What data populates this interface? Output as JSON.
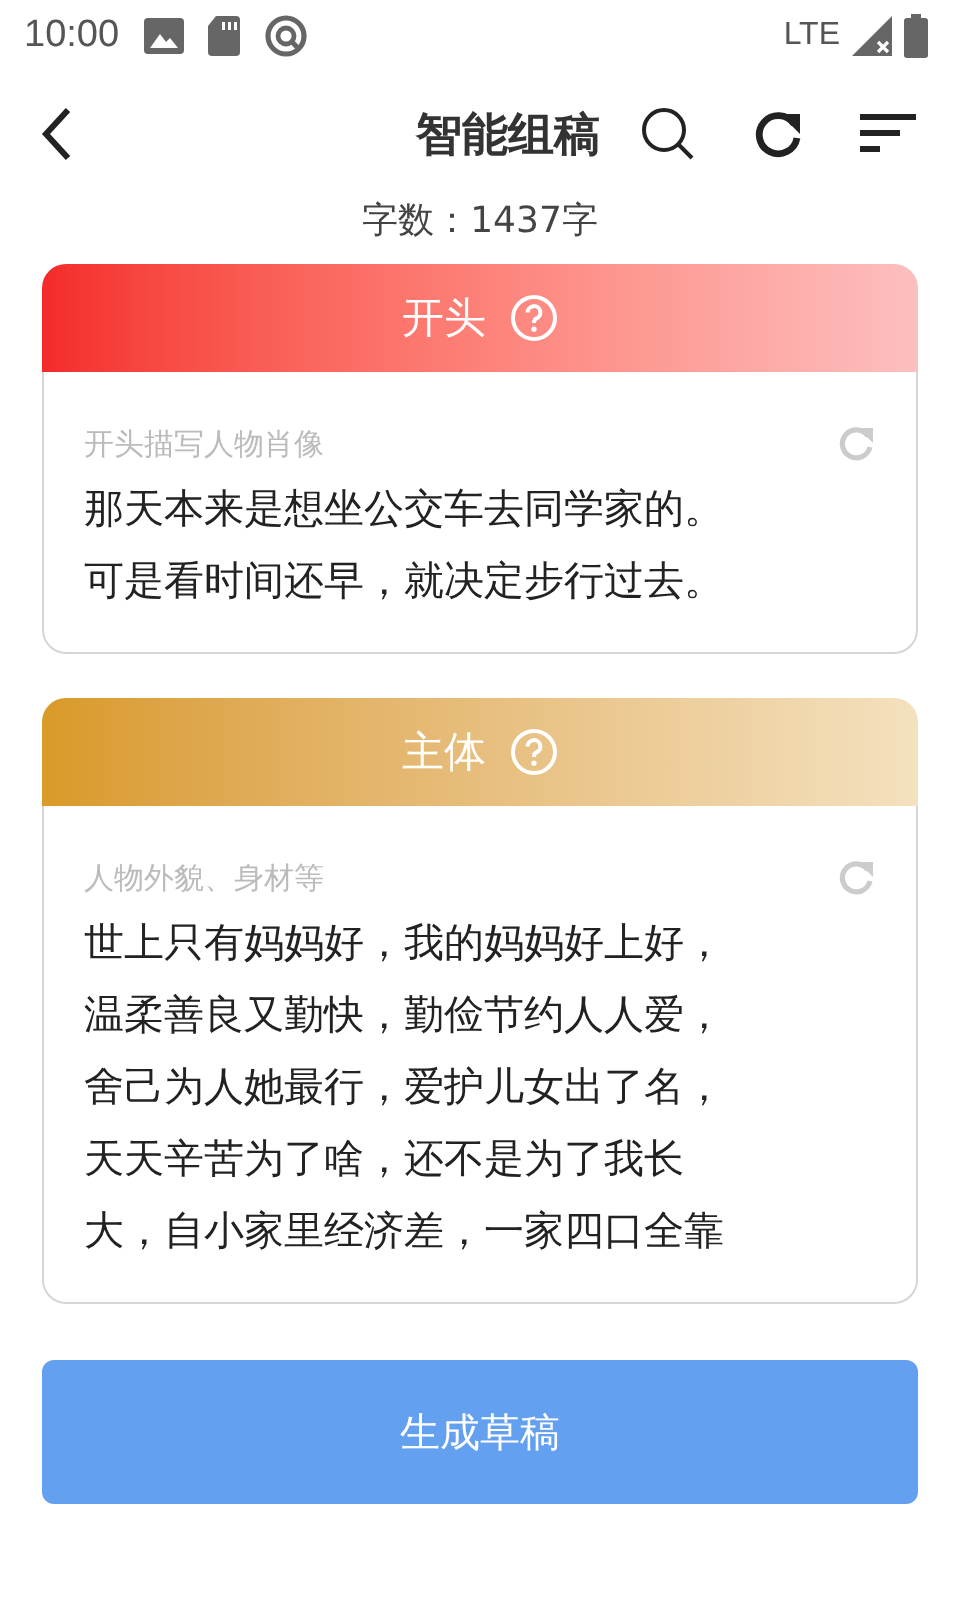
{
  "status_bar": {
    "time": "10:00",
    "network": "LTE"
  },
  "header": {
    "title": "智能组稿"
  },
  "word_count": "字数：1437字",
  "sections": [
    {
      "title": "开头",
      "color": "#f42a2a",
      "hint": "开头描写人物肖像",
      "lines": [
        "那天本来是想坐公交车去同学家的。",
        "可是看时间还早，就决定步行过去。"
      ]
    },
    {
      "title": "主体",
      "color": "#d99a28",
      "hint": "人物外貌、身材等",
      "lines": [
        "世上只有妈妈好，我的妈妈好上好，",
        "温柔善良又勤快，勤俭节约人人爱，",
        "舍己为人她最行，爱护儿女出了名，",
        "天天辛苦为了啥，还不是为了我长",
        "大，自小家里经济差，一家四口全靠"
      ]
    }
  ],
  "primary_button": "生成草稿"
}
